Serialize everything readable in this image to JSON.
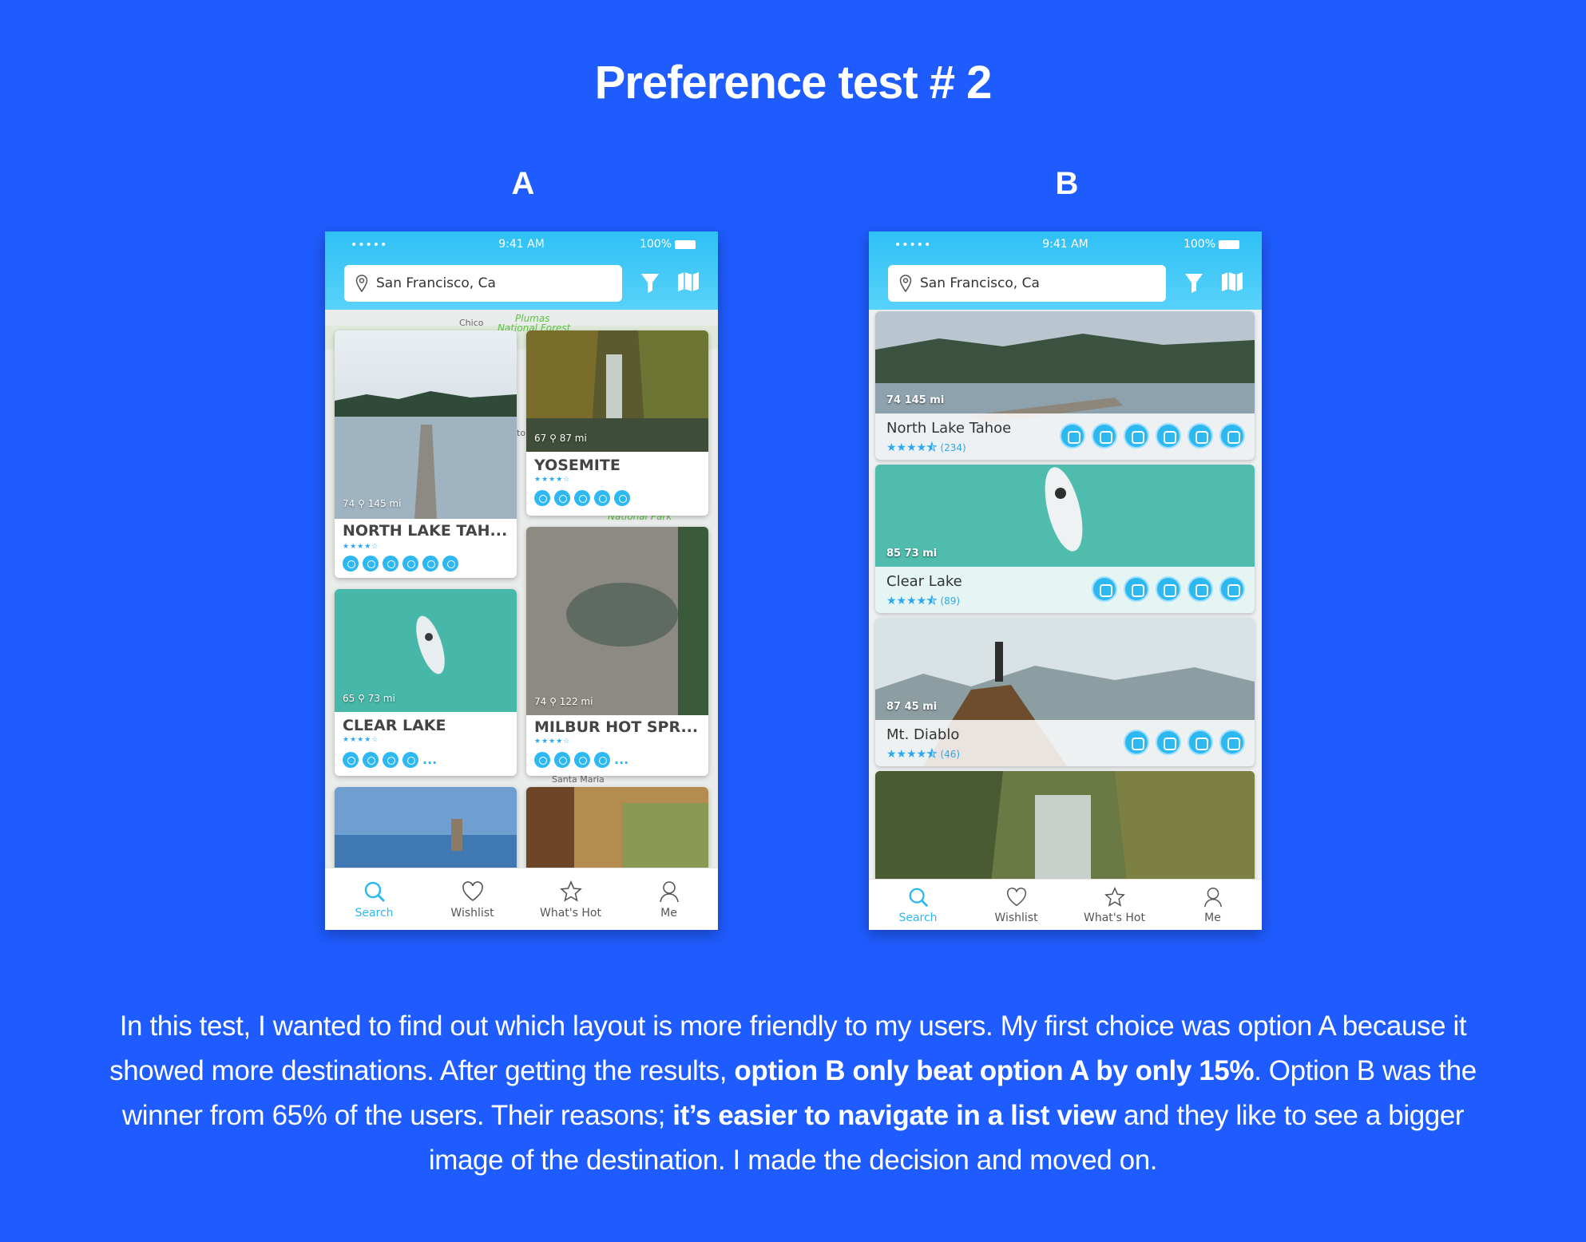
{
  "title": "Preference test # 2",
  "variants": {
    "a": {
      "label": "A"
    },
    "b": {
      "label": "B"
    }
  },
  "phone": {
    "status": {
      "signal": "•••••",
      "time": "9:41 AM",
      "battery": "100%"
    },
    "search": {
      "value": "San Francisco, Ca"
    },
    "tabs": [
      "Search",
      "Wishlist",
      "What's Hot",
      "Me"
    ]
  },
  "map_labels": {
    "chico": "Chico",
    "plumas": "Plumas",
    "national_forest": "National Forest",
    "national_park": "National Park",
    "to": "to",
    "santa_maria": "Santa Maria"
  },
  "option_a": {
    "cards": [
      {
        "name": "NORTH LAKE TAH...",
        "meta": "74  ⚲ 145 mi"
      },
      {
        "name": "YOSEMITE",
        "meta": "67  ⚲ 87 mi"
      },
      {
        "name": "CLEAR LAKE",
        "meta": "65  ⚲ 73 mi"
      },
      {
        "name": "MILBUR HOT SPR...",
        "meta": "74  ⚲ 122 mi"
      }
    ],
    "more": "..."
  },
  "option_b": {
    "cards": [
      {
        "name": "North Lake Tahoe",
        "meta": "74   145 mi",
        "reviews": "(234)"
      },
      {
        "name": "Clear Lake",
        "meta": "85   73 mi",
        "reviews": "(89)"
      },
      {
        "name": "Mt. Diablo",
        "meta": "87   45 mi",
        "reviews": "(46)"
      }
    ]
  },
  "stars": {
    "small": "★★★★☆",
    "large": "★★★★⯪"
  },
  "description": {
    "p1": "In this test, I wanted to find out which layout is more friendly to my users. My first choice was option A because it showed more destinations. After getting the results, ",
    "b1": "option B only beat option A by only 15%",
    "p2": ". Option B was the winner from 65% of the users. Their reasons; ",
    "b2": "it’s easier to navigate in a list view",
    "p3": " and they like to see a bigger image of the destination. I made the decision and moved on."
  },
  "colors": {
    "background": "#1f5cff",
    "accent": "#2eb8f2",
    "header": "#2fc0f5"
  }
}
